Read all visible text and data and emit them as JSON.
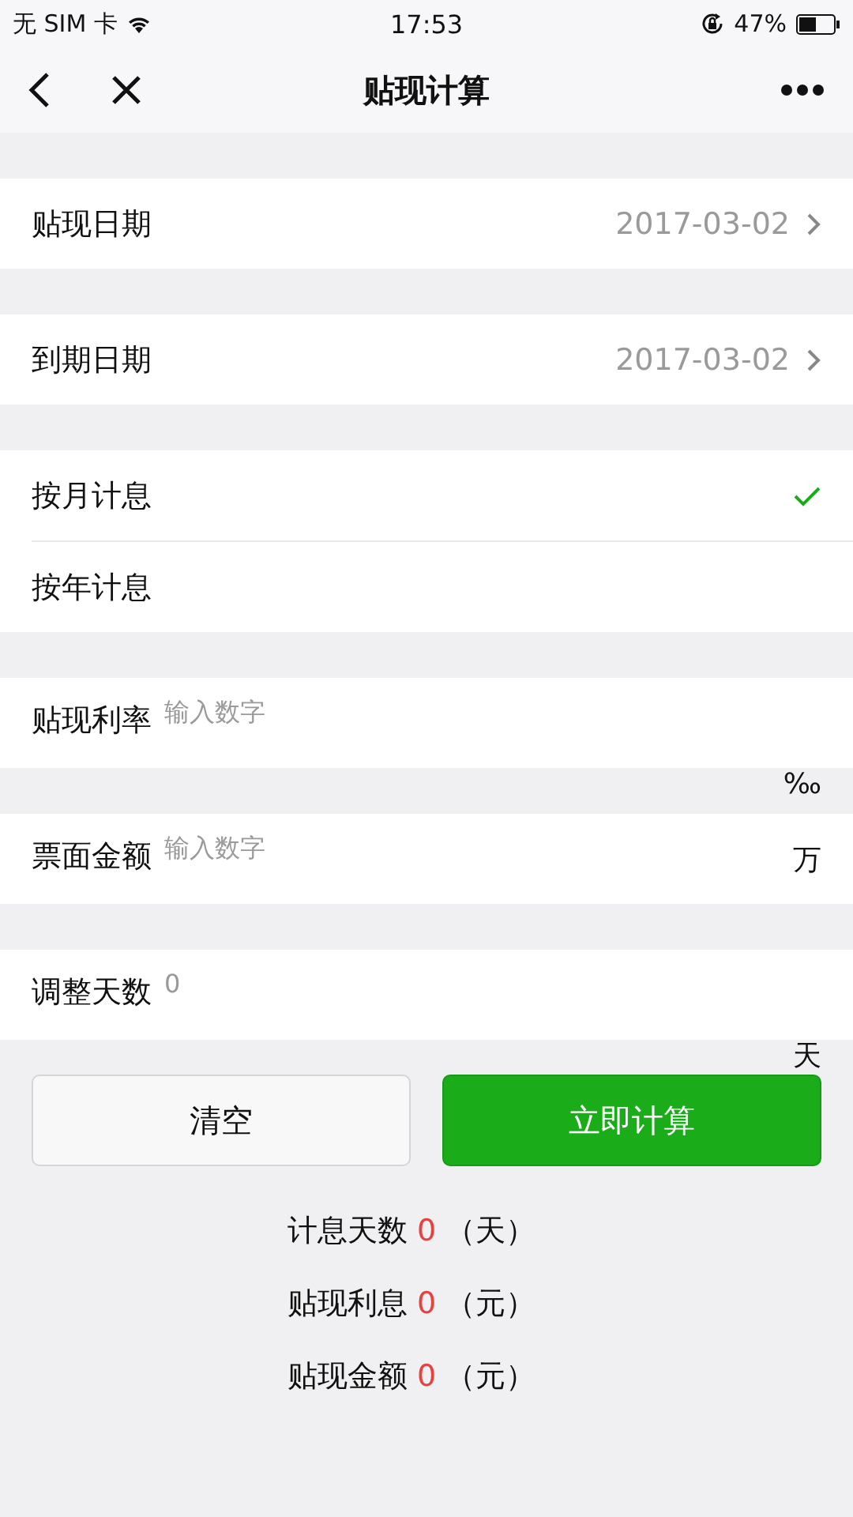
{
  "status_bar": {
    "carrier": "无 SIM 卡",
    "time": "17:53",
    "battery": "47%"
  },
  "nav": {
    "title": "贴现计算"
  },
  "date_rows": [
    {
      "label": "贴现日期",
      "value": "2017-03-02"
    },
    {
      "label": "到期日期",
      "value": "2017-03-02"
    }
  ],
  "interest_modes": [
    {
      "label": "按月计息",
      "selected": true
    },
    {
      "label": "按年计息",
      "selected": false
    }
  ],
  "fields": [
    {
      "label": "贴现利率",
      "placeholder": "输入数字",
      "unit": "‰",
      "unit_below": true
    },
    {
      "label": "票面金额",
      "placeholder": "输入数字",
      "unit": "万",
      "unit_below": false
    },
    {
      "label": "调整天数",
      "value": "0",
      "unit": "天",
      "unit_below": true
    }
  ],
  "buttons": [
    {
      "label": "清空",
      "kind": "secondary"
    },
    {
      "label": "立即计算",
      "kind": "primary"
    }
  ],
  "results": [
    {
      "label": "计息天数",
      "value": "0",
      "unit": "（天）"
    },
    {
      "label": "贴现利息",
      "value": "0",
      "unit": "（元）"
    },
    {
      "label": "贴现金额",
      "value": "0",
      "unit": "（元）"
    }
  ]
}
